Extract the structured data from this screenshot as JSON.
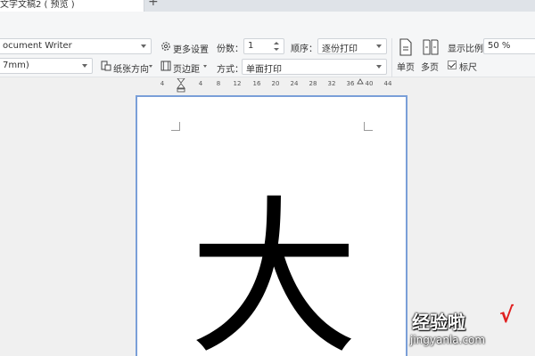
{
  "tab": {
    "title": "文字文稿2 ( 预览 )",
    "add_label": "+"
  },
  "printer": {
    "value": "ocument Writer"
  },
  "paper": {
    "value": "7mm)"
  },
  "more_settings": {
    "label": "更多设置"
  },
  "orientation": {
    "label": "纸张方向"
  },
  "margins": {
    "label": "页边距"
  },
  "copies": {
    "label": "份数：",
    "value": "1"
  },
  "order": {
    "label": "顺序：",
    "value": "逐份打印"
  },
  "mode": {
    "label": "方式：",
    "value": "单面打印"
  },
  "view": {
    "single_page": "单页",
    "multi_page": "多页"
  },
  "zoom": {
    "label": "显示比例",
    "value": "50 %"
  },
  "ruler_toggle": {
    "label": "标尺",
    "checked": true
  },
  "ruler": {
    "ticks": [
      "4",
      "4",
      "8",
      "12",
      "16",
      "20",
      "24",
      "28",
      "32",
      "36",
      "40",
      "44"
    ]
  },
  "document": {
    "character": "大"
  },
  "watermark": {
    "text": "经验啦",
    "check": "√",
    "url": "jingyanla.com"
  },
  "colors": {
    "accent": "#7a9fd8",
    "tab_dot": "#f0a51d",
    "watermark_check": "#e02020"
  }
}
